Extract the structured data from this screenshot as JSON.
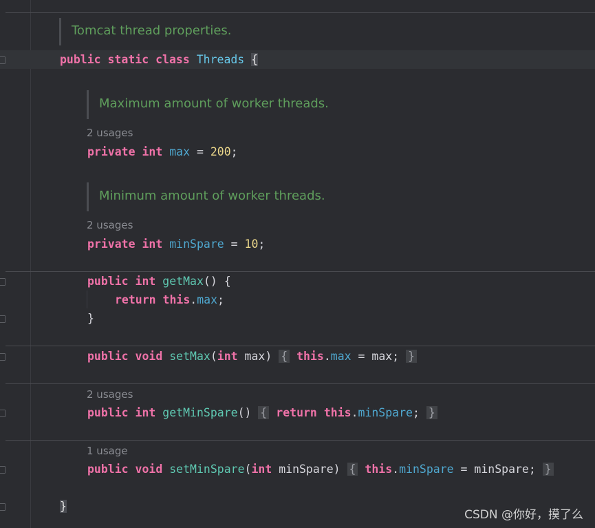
{
  "editor": {
    "class_doc": "Tomcat thread properties.",
    "class_decl": {
      "kw1": "public",
      "kw2": "static",
      "kw3": "class",
      "name": "Threads",
      "brace": "{"
    },
    "max_doc": "Maximum amount of worker threads.",
    "max_usages": "2 usages",
    "max_field": {
      "kw1": "private",
      "kw2": "int",
      "name": "max",
      "op": " = ",
      "value": "200",
      "end": ";"
    },
    "minspare_doc": "Minimum amount of worker threads.",
    "minspare_usages": "2 usages",
    "minspare_field": {
      "kw1": "private",
      "kw2": "int",
      "name": "minSpare",
      "op": " = ",
      "value": "10",
      "end": ";"
    },
    "getmax": {
      "kw1": "public",
      "kw2": "int",
      "name": "getMax",
      "sig": "() {",
      "body_kw1": "return",
      "body_kw2": "this",
      "body_dot": ".",
      "body_field": "max",
      "body_end": ";",
      "close": "}"
    },
    "setmax": {
      "kw1": "public",
      "kw2": "void",
      "name": "setMax",
      "open": "(",
      "pkw": "int",
      "pname": " max)",
      "fold_open": "{",
      "this": "this",
      "dot": ".",
      "field": "max",
      "rest": " = max;",
      "fold_close": "}"
    },
    "getminspare_usages": "2 usages",
    "getminspare": {
      "kw1": "public",
      "kw2": "int",
      "name": "getMinSpare",
      "sig": "()",
      "fold_open": "{",
      "ret": "return",
      "this": "this",
      "dot": ".",
      "field": "minSpare",
      "end": ";",
      "fold_close": "}"
    },
    "setminspare_usages": "1 usage",
    "setminspare": {
      "kw1": "public",
      "kw2": "void",
      "name": "setMinSpare",
      "open": "(",
      "pkw": "int",
      "pname": " minSpare)",
      "fold_open": "{",
      "this": "this",
      "dot": ".",
      "field": "minSpare",
      "rest": " = minSpare;",
      "fold_close": "}"
    },
    "class_close": "}"
  },
  "watermark": "CSDN @你好，摸了么"
}
